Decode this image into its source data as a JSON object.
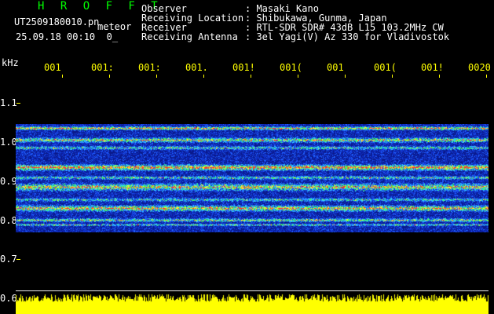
{
  "header": {
    "app_title": "H R O F F T",
    "file_name": "UT2509180010.pn",
    "event_label": "meteor",
    "datetime": "25.09.18 00:10",
    "datetime_suffix": "0_",
    "info": [
      {
        "label": "Observer",
        "value": ": Masaki Kano"
      },
      {
        "label": "Receiving Location",
        "value": ": Shibukawa, Gunma, Japan"
      },
      {
        "label": "Receiver",
        "value": ": RTL-SDR SDR# 43dB L15 103.2MHz CW"
      },
      {
        "label": "Receiving Antenna",
        "value": ": 3el Yagi(V) Az 330 for Vladivostok"
      }
    ]
  },
  "axis": {
    "unit": "kHz",
    "y_ticks": [
      "1.1",
      "1.0",
      "0.9",
      "0.8",
      "0.7",
      "0.6"
    ],
    "x_ticks": [
      "001",
      "001:",
      "001:",
      "001.",
      "001!",
      "001(",
      "001",
      "001(",
      "001!",
      "0020"
    ]
  },
  "colors": {
    "background": "#000000",
    "title": "#00ff00",
    "text": "#ffffff",
    "tick": "#ffff00",
    "level": "#ffff00",
    "spectrum_base": "#0a1a8c"
  }
}
